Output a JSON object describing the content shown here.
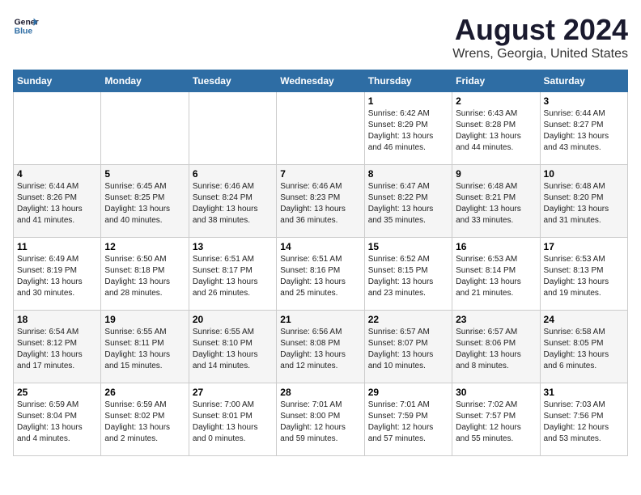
{
  "logo": {
    "text_general": "General",
    "text_blue": "Blue"
  },
  "title": "August 2024",
  "subtitle": "Wrens, Georgia, United States",
  "header": {
    "days": [
      "Sunday",
      "Monday",
      "Tuesday",
      "Wednesday",
      "Thursday",
      "Friday",
      "Saturday"
    ]
  },
  "weeks": [
    {
      "days": [
        {
          "num": "",
          "detail": ""
        },
        {
          "num": "",
          "detail": ""
        },
        {
          "num": "",
          "detail": ""
        },
        {
          "num": "",
          "detail": ""
        },
        {
          "num": "1",
          "detail": "Sunrise: 6:42 AM\nSunset: 8:29 PM\nDaylight: 13 hours\nand 46 minutes."
        },
        {
          "num": "2",
          "detail": "Sunrise: 6:43 AM\nSunset: 8:28 PM\nDaylight: 13 hours\nand 44 minutes."
        },
        {
          "num": "3",
          "detail": "Sunrise: 6:44 AM\nSunset: 8:27 PM\nDaylight: 13 hours\nand 43 minutes."
        }
      ]
    },
    {
      "days": [
        {
          "num": "4",
          "detail": "Sunrise: 6:44 AM\nSunset: 8:26 PM\nDaylight: 13 hours\nand 41 minutes."
        },
        {
          "num": "5",
          "detail": "Sunrise: 6:45 AM\nSunset: 8:25 PM\nDaylight: 13 hours\nand 40 minutes."
        },
        {
          "num": "6",
          "detail": "Sunrise: 6:46 AM\nSunset: 8:24 PM\nDaylight: 13 hours\nand 38 minutes."
        },
        {
          "num": "7",
          "detail": "Sunrise: 6:46 AM\nSunset: 8:23 PM\nDaylight: 13 hours\nand 36 minutes."
        },
        {
          "num": "8",
          "detail": "Sunrise: 6:47 AM\nSunset: 8:22 PM\nDaylight: 13 hours\nand 35 minutes."
        },
        {
          "num": "9",
          "detail": "Sunrise: 6:48 AM\nSunset: 8:21 PM\nDaylight: 13 hours\nand 33 minutes."
        },
        {
          "num": "10",
          "detail": "Sunrise: 6:48 AM\nSunset: 8:20 PM\nDaylight: 13 hours\nand 31 minutes."
        }
      ]
    },
    {
      "days": [
        {
          "num": "11",
          "detail": "Sunrise: 6:49 AM\nSunset: 8:19 PM\nDaylight: 13 hours\nand 30 minutes."
        },
        {
          "num": "12",
          "detail": "Sunrise: 6:50 AM\nSunset: 8:18 PM\nDaylight: 13 hours\nand 28 minutes."
        },
        {
          "num": "13",
          "detail": "Sunrise: 6:51 AM\nSunset: 8:17 PM\nDaylight: 13 hours\nand 26 minutes."
        },
        {
          "num": "14",
          "detail": "Sunrise: 6:51 AM\nSunset: 8:16 PM\nDaylight: 13 hours\nand 25 minutes."
        },
        {
          "num": "15",
          "detail": "Sunrise: 6:52 AM\nSunset: 8:15 PM\nDaylight: 13 hours\nand 23 minutes."
        },
        {
          "num": "16",
          "detail": "Sunrise: 6:53 AM\nSunset: 8:14 PM\nDaylight: 13 hours\nand 21 minutes."
        },
        {
          "num": "17",
          "detail": "Sunrise: 6:53 AM\nSunset: 8:13 PM\nDaylight: 13 hours\nand 19 minutes."
        }
      ]
    },
    {
      "days": [
        {
          "num": "18",
          "detail": "Sunrise: 6:54 AM\nSunset: 8:12 PM\nDaylight: 13 hours\nand 17 minutes."
        },
        {
          "num": "19",
          "detail": "Sunrise: 6:55 AM\nSunset: 8:11 PM\nDaylight: 13 hours\nand 15 minutes."
        },
        {
          "num": "20",
          "detail": "Sunrise: 6:55 AM\nSunset: 8:10 PM\nDaylight: 13 hours\nand 14 minutes."
        },
        {
          "num": "21",
          "detail": "Sunrise: 6:56 AM\nSunset: 8:08 PM\nDaylight: 13 hours\nand 12 minutes."
        },
        {
          "num": "22",
          "detail": "Sunrise: 6:57 AM\nSunset: 8:07 PM\nDaylight: 13 hours\nand 10 minutes."
        },
        {
          "num": "23",
          "detail": "Sunrise: 6:57 AM\nSunset: 8:06 PM\nDaylight: 13 hours\nand 8 minutes."
        },
        {
          "num": "24",
          "detail": "Sunrise: 6:58 AM\nSunset: 8:05 PM\nDaylight: 13 hours\nand 6 minutes."
        }
      ]
    },
    {
      "days": [
        {
          "num": "25",
          "detail": "Sunrise: 6:59 AM\nSunset: 8:04 PM\nDaylight: 13 hours\nand 4 minutes."
        },
        {
          "num": "26",
          "detail": "Sunrise: 6:59 AM\nSunset: 8:02 PM\nDaylight: 13 hours\nand 2 minutes."
        },
        {
          "num": "27",
          "detail": "Sunrise: 7:00 AM\nSunset: 8:01 PM\nDaylight: 13 hours\nand 0 minutes."
        },
        {
          "num": "28",
          "detail": "Sunrise: 7:01 AM\nSunset: 8:00 PM\nDaylight: 12 hours\nand 59 minutes."
        },
        {
          "num": "29",
          "detail": "Sunrise: 7:01 AM\nSunset: 7:59 PM\nDaylight: 12 hours\nand 57 minutes."
        },
        {
          "num": "30",
          "detail": "Sunrise: 7:02 AM\nSunset: 7:57 PM\nDaylight: 12 hours\nand 55 minutes."
        },
        {
          "num": "31",
          "detail": "Sunrise: 7:03 AM\nSunset: 7:56 PM\nDaylight: 12 hours\nand 53 minutes."
        }
      ]
    }
  ]
}
